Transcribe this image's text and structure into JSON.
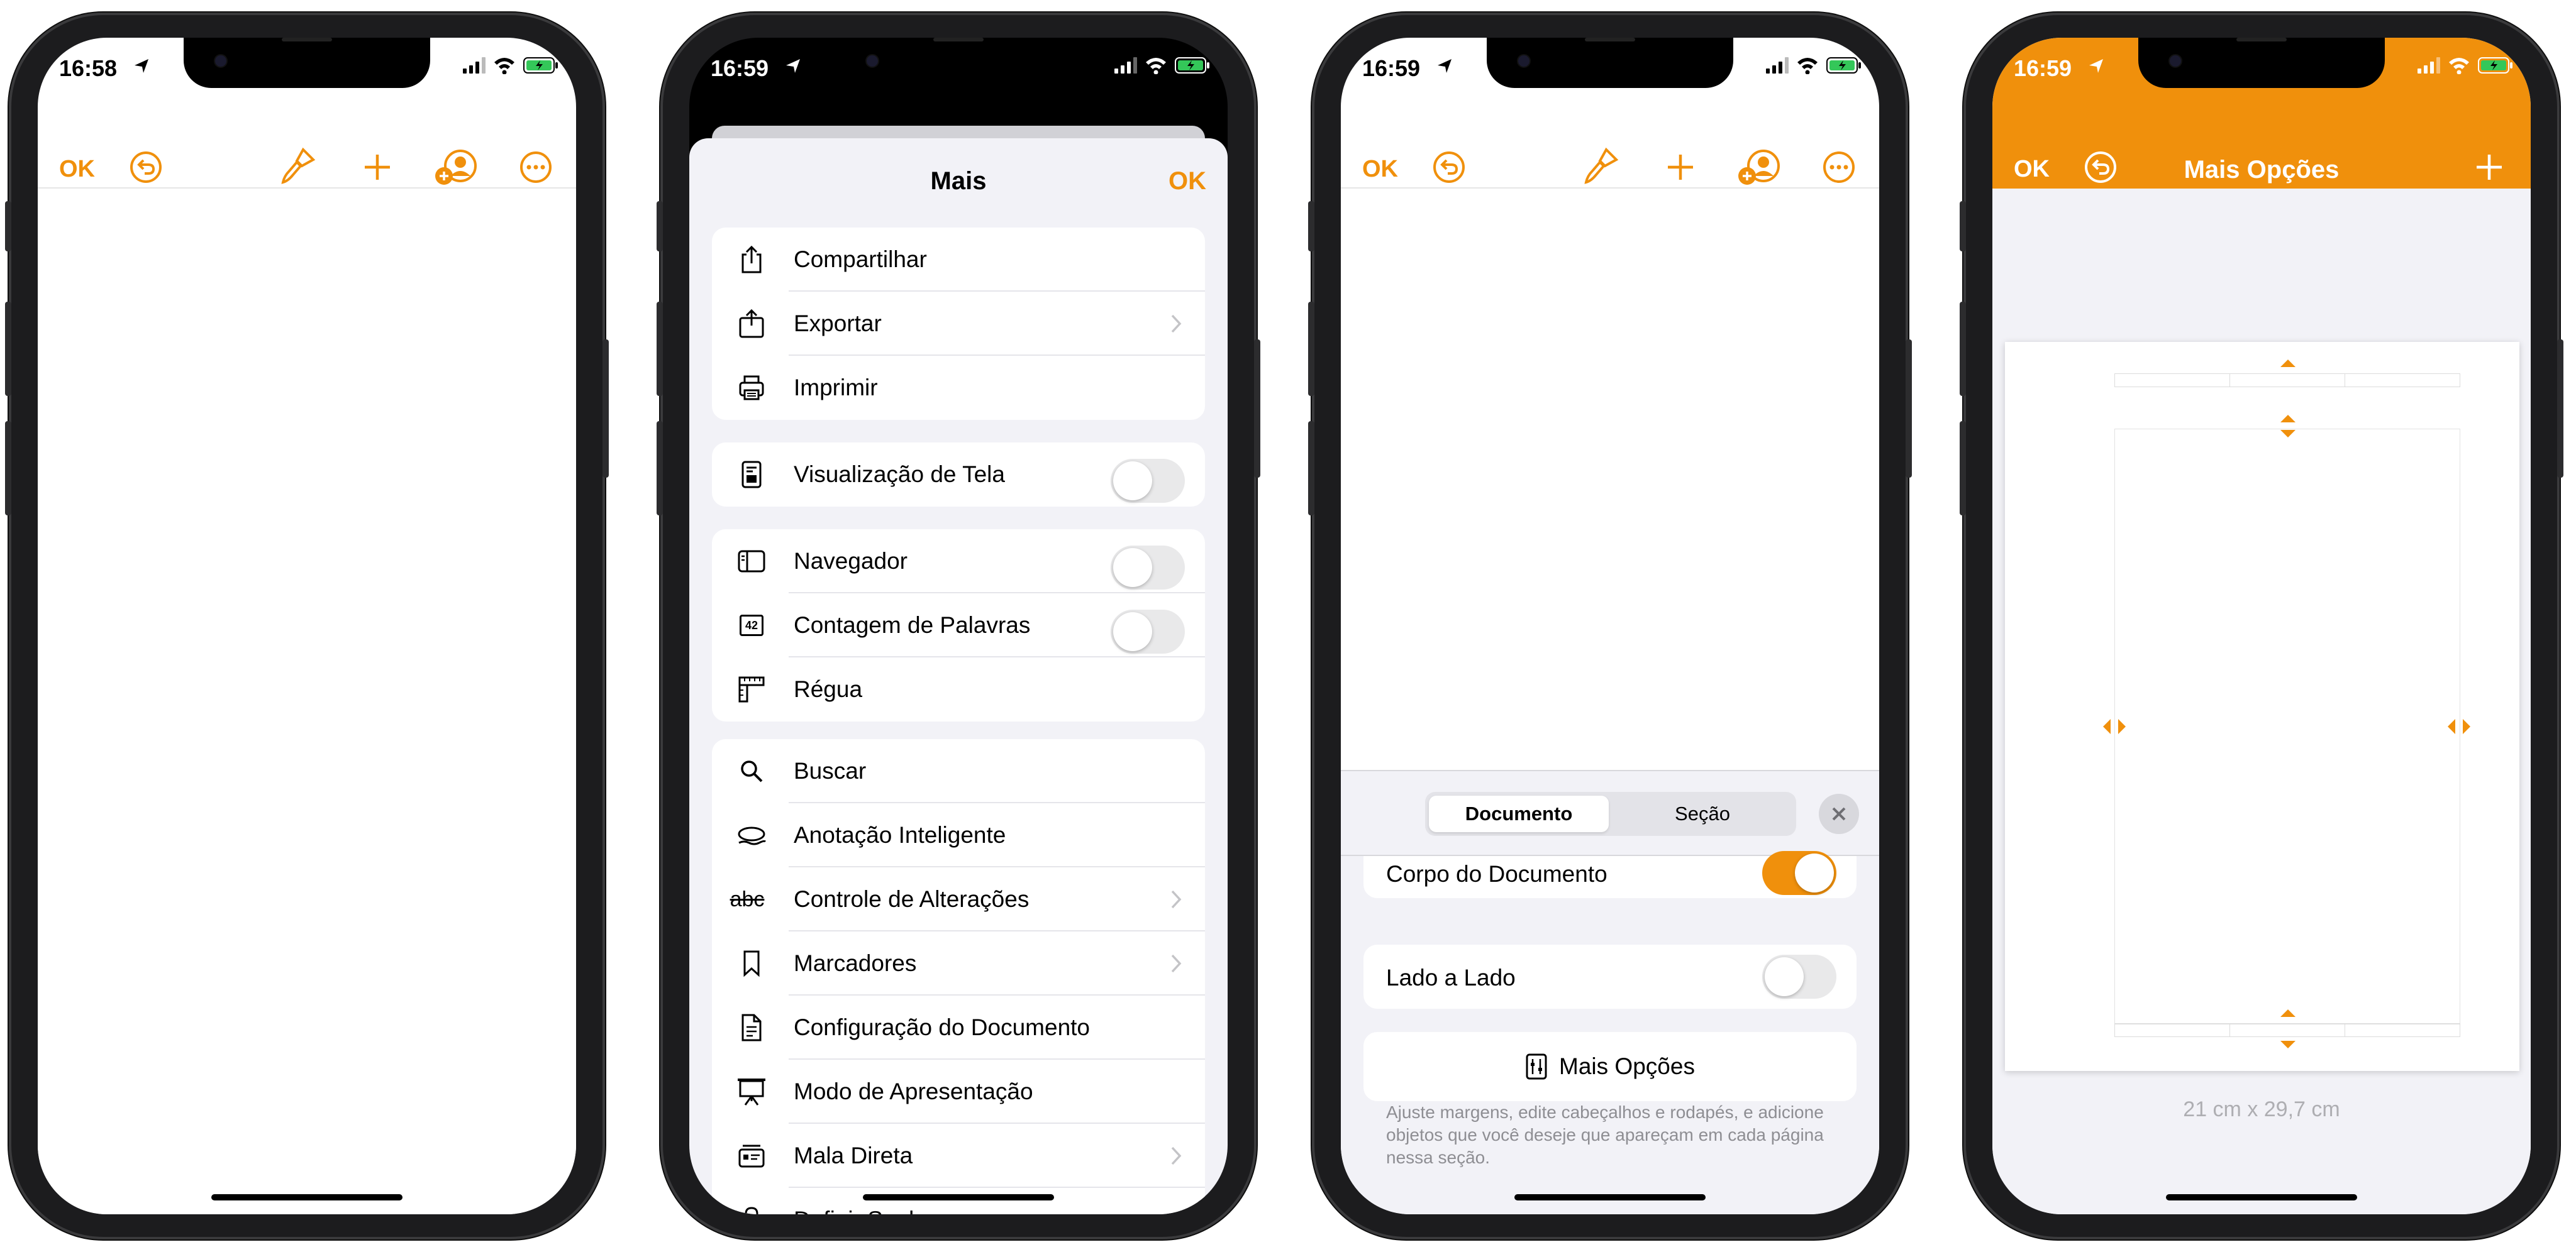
{
  "colors": {
    "accent": "#f0900c",
    "toggle_off": "#e9e9ea",
    "separator": "#e5e5ea",
    "sheet_bg": "#f2f2f7"
  },
  "phone1": {
    "status": {
      "time": "16:58"
    },
    "toolbar": {
      "ok": "OK",
      "icons": [
        "undo-icon",
        "paintbrush-icon",
        "plus-icon",
        "collaborate-icon",
        "more-icon"
      ]
    }
  },
  "phone2": {
    "status": {
      "time": "16:59"
    },
    "sheet": {
      "title": "Mais",
      "ok": "OK",
      "group1": [
        {
          "label": "Compartilhar",
          "icon": "share-icon"
        },
        {
          "label": "Exportar",
          "icon": "export-icon",
          "chevron": true
        },
        {
          "label": "Imprimir",
          "icon": "print-icon"
        }
      ],
      "group2": [
        {
          "label": "Visualização de Tela",
          "icon": "screen-view-icon",
          "toggle": false
        }
      ],
      "group3": [
        {
          "label": "Navegador",
          "icon": "sidebar-icon",
          "toggle": false
        },
        {
          "label": "Contagem de Palavras",
          "icon": "word-count-icon",
          "badge": "42",
          "toggle": false
        },
        {
          "label": "Régua",
          "icon": "ruler-icon"
        }
      ],
      "group4": [
        {
          "label": "Buscar",
          "icon": "search-icon"
        },
        {
          "label": "Anotação Inteligente",
          "icon": "smart-annotation-icon"
        },
        {
          "label": "Controle de Alterações",
          "icon": "track-changes-icon",
          "glyph": "abc",
          "chevron": true
        },
        {
          "label": "Marcadores",
          "icon": "bookmark-icon",
          "chevron": true
        },
        {
          "label": "Configuração do Documento",
          "icon": "document-icon"
        },
        {
          "label": "Modo de Apresentação",
          "icon": "presentation-icon"
        },
        {
          "label": "Mala Direta",
          "icon": "mail-merge-icon",
          "chevron": true
        },
        {
          "label": "Definir Senha",
          "icon": "lock-icon"
        }
      ]
    }
  },
  "phone3": {
    "status": {
      "time": "16:59"
    },
    "toolbar": {
      "ok": "OK"
    },
    "tabs": {
      "document": "Documento",
      "section": "Seção"
    },
    "rows": {
      "body": {
        "label": "Corpo do Documento",
        "toggle": true
      },
      "side_by_side": {
        "label": "Lado a Lado",
        "toggle": false
      },
      "more_options": {
        "label": "Mais Opções"
      }
    },
    "footnote": "Ajuste margens, edite cabeçalhos e rodapés, e adicione objetos que você deseje que apareçam em cada página nessa seção."
  },
  "phone4": {
    "status": {
      "time": "16:59"
    },
    "nav": {
      "ok": "OK",
      "title": "Mais Opções"
    },
    "paper_size": "21 cm x 29,7 cm"
  }
}
